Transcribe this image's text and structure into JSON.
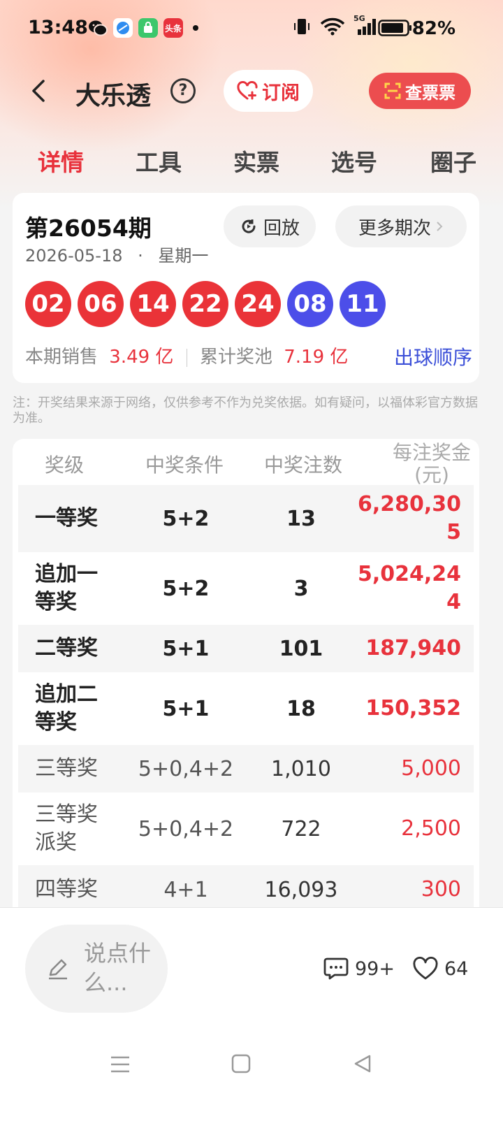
{
  "status_bar": {
    "time": "13:48",
    "battery": "82%",
    "network": "5G",
    "apps": [
      "wechat-icon",
      "browser-icon",
      "shop-icon",
      "toutiao-icon"
    ],
    "toutiao_label": "头条"
  },
  "header": {
    "title": "大乐透",
    "help": "?",
    "subscribe_label": "订阅",
    "check_ticket_label": "查票票"
  },
  "tabs": [
    {
      "label": "详情",
      "active": true
    },
    {
      "label": "工具",
      "active": false
    },
    {
      "label": "实票",
      "active": false
    },
    {
      "label": "选号",
      "active": false
    },
    {
      "label": "圈子",
      "active": false
    }
  ],
  "draw": {
    "issue": "第26054期",
    "date": "2026-05-18",
    "dot": "·",
    "weekday": "星期一",
    "replay_label": "回放",
    "more_label": "更多期次",
    "red_balls": [
      "02",
      "06",
      "14",
      "22",
      "24"
    ],
    "blue_balls": [
      "08",
      "11"
    ],
    "sales_label": "本期销售",
    "sales_value": "3.49 亿",
    "pool_label": "累计奖池",
    "pool_value": "7.19 亿",
    "ball_order_label": "出球顺序"
  },
  "note": "注：开奖结果来源于网络，仅供参考不作为兑奖依据。如有疑问，以福体彩官方数据为准。",
  "prize_table": {
    "headers": [
      "奖级",
      "中奖条件",
      "中奖注数",
      "每注奖金(元)"
    ],
    "rows": [
      {
        "level": "一等奖",
        "condition": "5+2",
        "count": "13",
        "amount": "6,280,305"
      },
      {
        "level": "追加一等奖",
        "condition": "5+2",
        "count": "3",
        "amount": "5,024,244"
      },
      {
        "level": "二等奖",
        "condition": "5+1",
        "count": "101",
        "amount": "187,940"
      },
      {
        "level": "追加二等奖",
        "condition": "5+1",
        "count": "18",
        "amount": "150,352"
      },
      {
        "level": "三等奖",
        "condition": "5+0,4+2",
        "count": "1,010",
        "amount": "5,000"
      },
      {
        "level": "三等奖派奖",
        "condition": "5+0,4+2",
        "count": "722",
        "amount": "2,500"
      },
      {
        "level": "四等奖",
        "condition": "4+1",
        "count": "16,093",
        "amount": "300"
      }
    ]
  },
  "bottom": {
    "comment_placeholder": "说点什么...",
    "comment_count": "99+",
    "like_count": "64"
  },
  "colors": {
    "accent_red": "#e8323c",
    "ball_red": "#ea3338",
    "ball_blue": "#4c4ee9",
    "link_blue": "#3b4fd8"
  }
}
